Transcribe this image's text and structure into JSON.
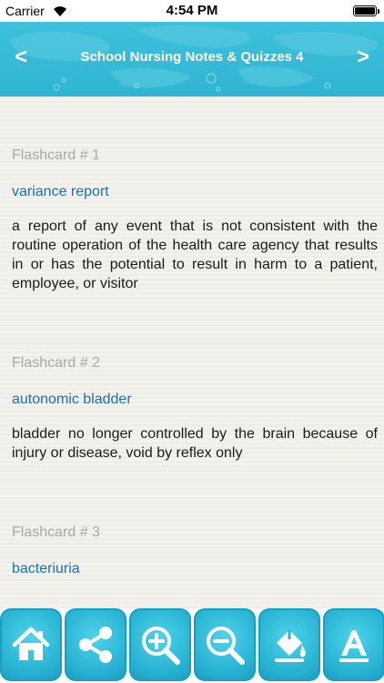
{
  "status_bar": {
    "carrier": "Carrier",
    "time": "4:54 PM"
  },
  "header": {
    "title": "School Nursing Notes & Quizzes 4",
    "back_label": "<",
    "next_label": ">"
  },
  "flashcards": [
    {
      "number": "Flashcard # 1",
      "term": "variance report",
      "definition": "a report of any event that is not consistent with the routine operation of the health care agency that results in or has the potential to result in harm to a patient, employee, or visitor"
    },
    {
      "number": "Flashcard # 2",
      "term": "autonomic bladder",
      "definition": "bladder no longer controlled by the brain because of injury or disease, void by reflex only"
    },
    {
      "number": "Flashcard # 3",
      "term": "bacteriuria",
      "definition": ""
    }
  ],
  "toolbar": {
    "icons": [
      "home-icon",
      "share-icon",
      "zoom-in-icon",
      "zoom-out-icon",
      "paint-bucket-icon",
      "font-icon"
    ]
  },
  "colors": {
    "accent": "#2fb4d2",
    "term": "#1d6fae",
    "flashcard_number": "#a8a8a8"
  }
}
